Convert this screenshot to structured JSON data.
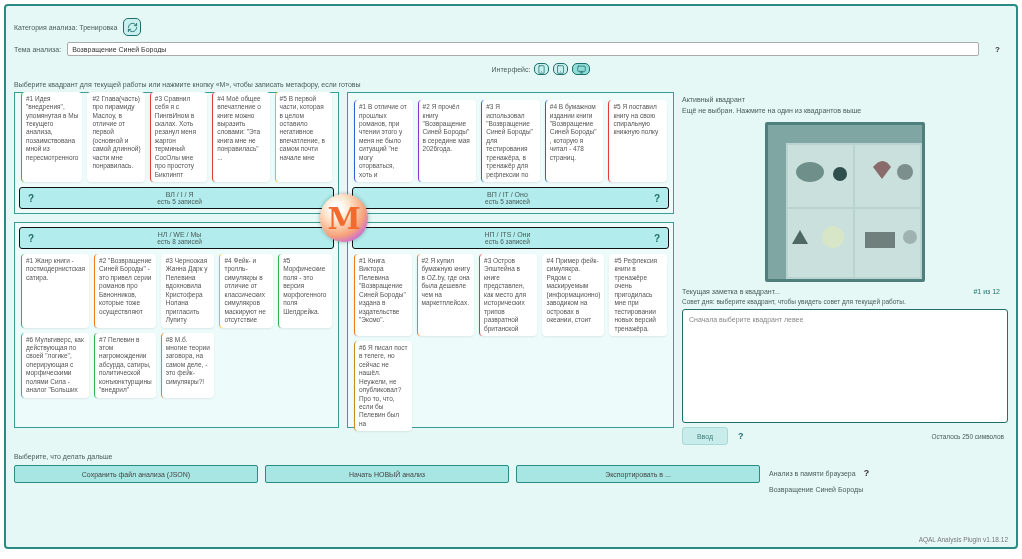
{
  "category": {
    "label": "Категория анализа: Тренировка"
  },
  "topic": {
    "label": "Тема анализа:",
    "value": "Возвращение Синей Бороды",
    "help": "?"
  },
  "interface": {
    "label": "Интерфейс:",
    "modes": [
      {
        "kind": "phone",
        "selected": false
      },
      {
        "kind": "tablet",
        "selected": false
      },
      {
        "kind": "desktop",
        "selected": true
      }
    ]
  },
  "instruction": "Выберите квадрант для текущей работы или нажмите кнопку «М», чтобы записать метафору, если готовы",
  "m_button": {
    "label": "M"
  },
  "quadrants": [
    {
      "help": "?",
      "title": "ВЛ / I / Я",
      "count": "есть 5 записей",
      "cards": [
        {
          "text": "#1 Идея \"внедрения\", упомянутая в Мы текущего анализа, позаимствована мной из пересмотренного",
          "color": "#2fb34a"
        },
        {
          "text": "#2 Глава(часть) про пирамиду Маслоу, в отличие от первой (основной и самой длинной) части мне понравилась."
        },
        {
          "text": "#3 Сравнил себя я с ПингвИном в скалах. Хоть резанул меня жаргон терминый СоcОлы мне про простоту Биклинпт",
          "color": "#e53935"
        },
        {
          "text": "#4 Моё общее впечатление о книге можно выразить словами: \"Эта книга мне не понравилась\" ...",
          "color": "#e53935"
        },
        {
          "text": "#5 В первой части, которая в целом оставило негативное впечатление, в самом почти начале мне",
          "color": "#e6b800"
        }
      ]
    },
    {
      "help": "?",
      "title": "ВП / IT / Оно",
      "count": "есть 5 записей",
      "cards": [
        {
          "text": "#1 В отличие от прошлых романов, при чтении этого у меня не было ситуаций \"не могу оторваться, хоть и",
          "color": "#2e5fd8"
        },
        {
          "text": "#2 Я прочёл книгу \"Возвращение Синей Бороды\" в середине мая 2026года.",
          "color": "#8e2fd8"
        },
        {
          "text": "#3 Я использовал \"Возвращение Синей Бороды\" для тестирования тренажёра, в тренажёр для рефлексии по",
          "color": "#2e5fd8"
        },
        {
          "text": "#4 В бумажном издании книги \"Возвращение Синей Бороды\" , которую я читал - 478 страниц.",
          "color": "#2e5fd8"
        },
        {
          "text": "#5 Я поставил книгу на свою спиральную книжную полку",
          "color": "#e53935"
        }
      ]
    },
    {
      "help": "?",
      "title": "НЛ / WE / Мы",
      "count": "есть 8 записей",
      "cards": [
        {
          "text": "#1 Жанр книги - постмодернистская сатира.",
          "color": "#2fb34a"
        },
        {
          "text": "#2 \"Возвращение Синей Бороды\" - это привел серии романов про Бвнонников, которые тоже осуществляют",
          "color": "#f07a1a"
        },
        {
          "text": "#3 Черноокая Жанна Дарк у Пелевина вдохновила Кристофера Нолана пригласить Лупиту"
        },
        {
          "text": "#4 Фейк- и тролль-симулякры в отличие от классических симулякров маскируют не отсутствие",
          "color": "#e6b800"
        },
        {
          "text": "#5 Морфические поля - это версия морфогенного поля Шелдрейка.",
          "color": "#2fb34a"
        },
        {
          "text": "#6 Мультиверс, как действующая по своей \"логике\", оперирующая с морфическими полями Сила - аналог \"Больших",
          "color": "#1fb0b8"
        },
        {
          "text": "#7 Пелевин в этом нагромождении абсурда, сатиры, политической конъюнктурщины \"внедрил\"",
          "color": "#2fb34a"
        },
        {
          "text": "#8 М.б. многие теории заговора, на самом деле, - это фейк-симулякры?!",
          "color": "#f07a1a"
        }
      ]
    },
    {
      "help": "?",
      "title": "НП / ITS / Они",
      "count": "есть 6 записей",
      "cards": [
        {
          "text": "#1 Книга Виктора Пелевина \"Возвращение Синей Бороды\" издана в издательстве \"Эксмо\".",
          "color": "#f07a1a"
        },
        {
          "text": "#2 Я купил бумажную книгу в OZ.by, где она была дешевле чем на маркетплейсах.",
          "color": "#f07a1a"
        },
        {
          "text": "#3 Остров Эпштейна в книге представлен, как место для исторических трипов развратной британской",
          "color": "#e53935"
        },
        {
          "text": "#4 Пример фейк-симулякра. Рядом с маскируемым (информационно) заводиком на островах в океании, стоит"
        },
        {
          "text": "#5 Рефлексия книги в тренажёре очень пригодилась мне при тестировании новых версий тренажёра."
        },
        {
          "text": "#6 Я писал пост в телеге, но сейчас не нашёл. Неужели, не опубликовал? Про то, что, если бы Пелевин был на",
          "color": "#c98a1a"
        }
      ]
    }
  ],
  "active": {
    "title": "Активный квадрант",
    "text": "Ещё не выбран. Нажмите на один из квадрантов выше"
  },
  "note": {
    "title": "Текущая заметка в квадрант...",
    "counter": "#1 из 12",
    "tip": "Совет дня: выберите квадрант, чтобы увидеть совет для текущей работы.",
    "placeholder": "Сначала выберите квадрант левее",
    "submit": {
      "label": "Ввод",
      "disabled": true
    },
    "help": "?",
    "remaining": "Осталось 250 символов"
  },
  "next": {
    "title": "Выберите, что делать дальше",
    "buttons": [
      "Сохранить файл анализа (JSON)",
      "Начать НОВЫЙ анализ",
      "Экспортировать в ..."
    ],
    "memory_label": "Анализ в памяти браузера",
    "help": "?",
    "memory_item": "Возвращение Синей Бороды"
  },
  "footer": "AQAL Analysis Plugin v1.18.12"
}
